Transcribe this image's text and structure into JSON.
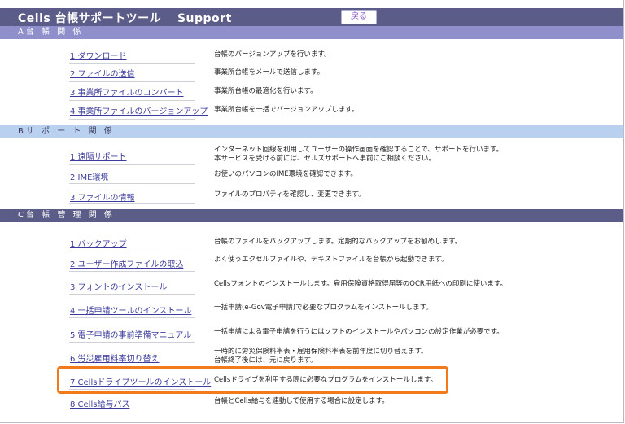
{
  "app": {
    "title": "Cells 台帳サポートツール　 Support",
    "back_label": "戻る"
  },
  "sections": [
    {
      "header": "A台 帳 関 係",
      "items": [
        {
          "label": "1 ダウンロード",
          "desc": [
            "台帳のバージョンアップを行います。"
          ]
        },
        {
          "label": "2 ファイルの送信",
          "desc": [
            "事業所台帳をメールで送信します。"
          ]
        },
        {
          "label": "3 事業所ファイルのコンバート",
          "desc": [
            "事業所台帳の最適化を行います。"
          ]
        },
        {
          "label": "4 事業所ファイルのバージョンアップ",
          "desc": [
            "事業所台帳を一括でバージョンアップします。"
          ]
        }
      ]
    },
    {
      "header": "Bサ ポ ー ト 関 係",
      "items": [
        {
          "label": "1 遠隔サポート",
          "desc": [
            "インターネット回線を利用してユーザーの操作画面を確認することで、サポートを行います。",
            "本サービスを受ける前には、セルズサポートへ事前にご相談ください。"
          ]
        },
        {
          "label": "2 IME環境",
          "desc": [
            "お使いのパソコンのIME環境を確認できます。"
          ]
        },
        {
          "label": "3 ファイルの情報",
          "desc": [
            "ファイルのプロパティを確認し、変更できます。"
          ]
        }
      ]
    },
    {
      "header": "C台 帳 管 理 関 係",
      "items": [
        {
          "label": "1 バックアップ",
          "desc": [
            "台帳のファイルをバックアップします。定期的なバックアップをお勧めします。"
          ]
        },
        {
          "label": "2 ユーザー作成ファイルの取込",
          "desc": [
            "よく使うエクセルファイルや、テキストファイルを台帳から起動できます。"
          ]
        },
        {
          "label": "3 フォントのインストール",
          "desc": [
            "Cellsフォントのインストールします。雇用保険資格取得届等のOCR用紙への印刷に使います。"
          ]
        },
        {
          "label": "4 一括申請ツールのインストール",
          "desc": [
            "一括申請(e-Gov電子申請)で必要なプログラムをインストールします。"
          ]
        },
        {
          "label": "5 電子申請の事前準備マニュアル",
          "desc": [
            "一括申請による電子申請を行うにはソフトのインストールやパソコンの設定作業が必要です。"
          ]
        },
        {
          "label": "6 労災雇用料率切り替え",
          "desc": [
            "一時的に労災保険料率表・雇用保険料率表を前年度に切り替えます。",
            "台帳終了後には、元に戻ります。"
          ]
        },
        {
          "label": "7 Cellsドライブツールのインストール",
          "desc": [
            "Cellsドライブを利用する際に必要なプログラムをインストールします。"
          ]
        },
        {
          "label": "8 Cells給与パス",
          "desc": [
            "台帳とCells給与を連動して使用する場合に設定します。"
          ]
        }
      ]
    }
  ],
  "colors": {
    "title_bar": "#5c5c88",
    "section_a": "#8f8fcc",
    "section_b": "#b9d0ef",
    "section_c": "#5c5c88",
    "link": "#3c3c9c",
    "highlight": "#f27a1a"
  }
}
